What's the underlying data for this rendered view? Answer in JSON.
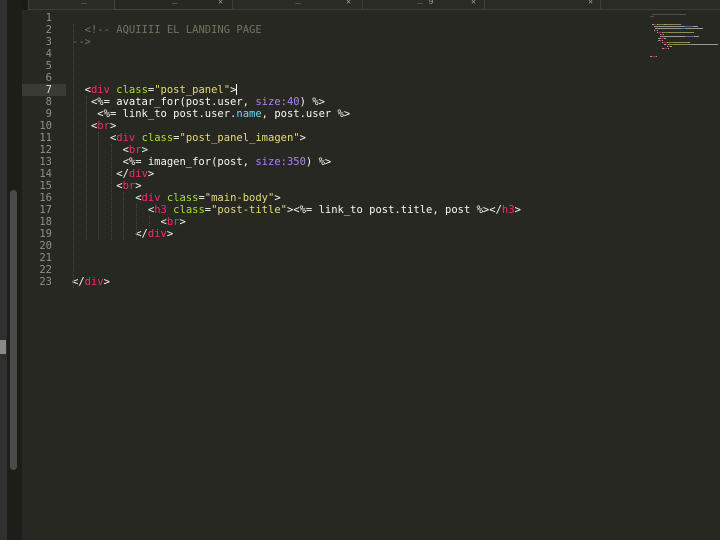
{
  "tabs": [
    {
      "label": "_",
      "active": false
    },
    {
      "label": "_",
      "active": true
    },
    {
      "label": "_",
      "active": false
    },
    {
      "label": "_ g",
      "active": false
    },
    {
      "label": "",
      "active": false
    },
    {
      "label": "",
      "active": false
    }
  ],
  "editor": {
    "current_line": 7,
    "lines": [
      {
        "n": "1",
        "indent": 0,
        "tokens": []
      },
      {
        "n": "2",
        "indent": 2,
        "tokens": [
          {
            "t": "comment",
            "v": "<!-- AQUIIII EL LANDING PAGE"
          }
        ]
      },
      {
        "n": "3",
        "indent": 0,
        "tokens": [
          {
            "t": "comment",
            "v": "-->"
          }
        ]
      },
      {
        "n": "4",
        "indent": 0,
        "tokens": []
      },
      {
        "n": "5",
        "indent": 0,
        "tokens": []
      },
      {
        "n": "6",
        "indent": 0,
        "tokens": []
      },
      {
        "n": "7",
        "indent": 2,
        "tokens": [
          {
            "t": "plain",
            "v": "<"
          },
          {
            "t": "tag",
            "v": "div"
          },
          {
            "t": "plain",
            "v": " "
          },
          {
            "t": "attr",
            "v": "class"
          },
          {
            "t": "plain",
            "v": "="
          },
          {
            "t": "str",
            "v": "\"post_panel\""
          },
          {
            "t": "plain",
            "v": ">"
          }
        ],
        "cursor": true
      },
      {
        "n": "8",
        "indent": 3,
        "tokens": [
          {
            "t": "plain",
            "v": "<%= avatar_for(post.user, "
          },
          {
            "t": "num",
            "v": "size:"
          },
          {
            "t": "num",
            "v": "40"
          },
          {
            "t": "plain",
            "v": ") %>"
          }
        ]
      },
      {
        "n": "9",
        "indent": 4,
        "tokens": [
          {
            "t": "plain",
            "v": "<%= link_to post.user."
          },
          {
            "t": "method",
            "v": "name"
          },
          {
            "t": "plain",
            "v": ", post.user %>"
          }
        ]
      },
      {
        "n": "10",
        "indent": 3,
        "tokens": [
          {
            "t": "plain",
            "v": "<"
          },
          {
            "t": "tag",
            "v": "br"
          },
          {
            "t": "plain",
            "v": ">"
          }
        ]
      },
      {
        "n": "11",
        "indent": 6,
        "tokens": [
          {
            "t": "plain",
            "v": "<"
          },
          {
            "t": "tag",
            "v": "div"
          },
          {
            "t": "plain",
            "v": " "
          },
          {
            "t": "attr",
            "v": "class"
          },
          {
            "t": "plain",
            "v": "="
          },
          {
            "t": "str",
            "v": "\"post_panel_imagen\""
          },
          {
            "t": "plain",
            "v": ">"
          }
        ]
      },
      {
        "n": "12",
        "indent": 8,
        "tokens": [
          {
            "t": "plain",
            "v": "<"
          },
          {
            "t": "tag",
            "v": "br"
          },
          {
            "t": "plain",
            "v": ">"
          }
        ]
      },
      {
        "n": "13",
        "indent": 8,
        "tokens": [
          {
            "t": "plain",
            "v": "<%= imagen_for(post, "
          },
          {
            "t": "num",
            "v": "size:"
          },
          {
            "t": "num",
            "v": "350"
          },
          {
            "t": "plain",
            "v": ") %>"
          }
        ]
      },
      {
        "n": "14",
        "indent": 7,
        "tokens": [
          {
            "t": "plain",
            "v": "</"
          },
          {
            "t": "tag",
            "v": "div"
          },
          {
            "t": "plain",
            "v": ">"
          }
        ]
      },
      {
        "n": "15",
        "indent": 7,
        "tokens": [
          {
            "t": "plain",
            "v": "<"
          },
          {
            "t": "tag",
            "v": "br"
          },
          {
            "t": "plain",
            "v": ">"
          }
        ]
      },
      {
        "n": "16",
        "indent": 10,
        "tokens": [
          {
            "t": "plain",
            "v": "<"
          },
          {
            "t": "tag",
            "v": "div"
          },
          {
            "t": "plain",
            "v": " "
          },
          {
            "t": "attr",
            "v": "class"
          },
          {
            "t": "plain",
            "v": "="
          },
          {
            "t": "str",
            "v": "\"main-body\""
          },
          {
            "t": "plain",
            "v": ">"
          }
        ]
      },
      {
        "n": "17",
        "indent": 12,
        "tokens": [
          {
            "t": "plain",
            "v": "<"
          },
          {
            "t": "tag",
            "v": "h3"
          },
          {
            "t": "plain",
            "v": " "
          },
          {
            "t": "attr",
            "v": "class"
          },
          {
            "t": "plain",
            "v": "="
          },
          {
            "t": "str",
            "v": "\"post-title\""
          },
          {
            "t": "plain",
            "v": "><%= link_to post.title, post %></"
          },
          {
            "t": "tag",
            "v": "h3"
          },
          {
            "t": "plain",
            "v": ">"
          }
        ]
      },
      {
        "n": "18",
        "indent": 14,
        "tokens": [
          {
            "t": "plain",
            "v": "<"
          },
          {
            "t": "tag",
            "v": "br"
          },
          {
            "t": "plain",
            "v": ">"
          }
        ]
      },
      {
        "n": "19",
        "indent": 10,
        "tokens": [
          {
            "t": "plain",
            "v": "</"
          },
          {
            "t": "tag",
            "v": "div"
          },
          {
            "t": "plain",
            "v": ">"
          }
        ]
      },
      {
        "n": "20",
        "indent": 0,
        "tokens": []
      },
      {
        "n": "21",
        "indent": 0,
        "tokens": []
      },
      {
        "n": "22",
        "indent": 0,
        "tokens": []
      },
      {
        "n": "23",
        "indent": 0,
        "tokens": [
          {
            "t": "plain",
            "v": "</"
          },
          {
            "t": "tag",
            "v": "div"
          },
          {
            "t": "plain",
            "v": ">"
          }
        ]
      }
    ]
  },
  "colors": {
    "background": "#272822",
    "tag": "#f92672",
    "attribute": "#a6e22e",
    "string": "#e6db74",
    "number": "#ae81ff",
    "method": "#66d9ef",
    "comment": "#75715e",
    "text": "#f8f8f2"
  }
}
